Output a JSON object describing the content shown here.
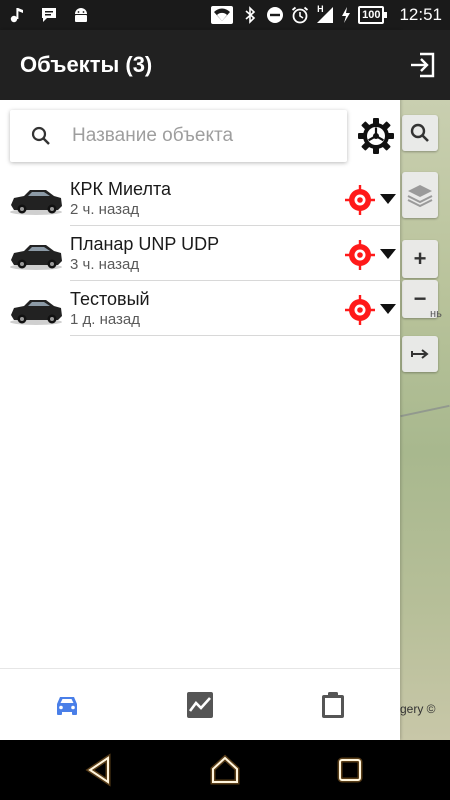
{
  "status_bar": {
    "left_icons": [
      "music-note-icon",
      "chat-icon",
      "android-icon"
    ],
    "right_icons": [
      "wifi-icon",
      "bluetooth-icon",
      "dnd-icon",
      "alarm-icon",
      "signal-icon"
    ],
    "network": "H",
    "battery": "100",
    "time": "12:51"
  },
  "header": {
    "title": "Объекты (3)",
    "exit_icon": "exit-icon"
  },
  "search": {
    "placeholder": "Название объекта",
    "value": "",
    "settings_icon": "gear-icon"
  },
  "objects": [
    {
      "name": "КРК Миелта",
      "time": "2 ч. назад"
    },
    {
      "name": "Планар UNP UDP",
      "time": "3 ч. назад"
    },
    {
      "name": "Тестовый",
      "time": "1 д. назад"
    }
  ],
  "map": {
    "zoom_in": "+",
    "zoom_out": "−",
    "credit": "gery ©",
    "faint_label": "нь"
  },
  "bottom_nav": {
    "tabs": [
      "car-icon",
      "chart-icon",
      "clipboard-icon"
    ],
    "active": 0,
    "active_color": "#4a7fe8"
  },
  "colors": {
    "appbar": "#212121",
    "target": "#ff0000"
  }
}
